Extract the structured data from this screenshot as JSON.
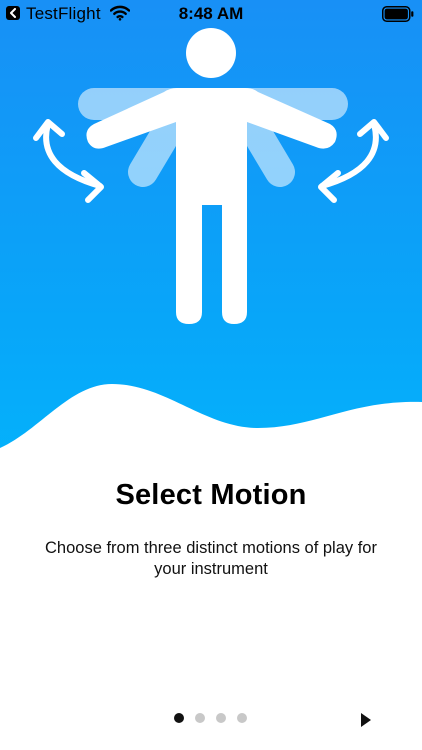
{
  "status_bar": {
    "back_app": "TestFlight",
    "time": "8:48 AM"
  },
  "onboarding": {
    "illustration": "person-motion-icon",
    "title": "Select Motion",
    "description": "Choose from three distinct motions of play for your instrument",
    "page_count": 4,
    "current_page": 1
  },
  "colors": {
    "gradient_top": "#1890f6",
    "gradient_bottom": "#04b1fb",
    "title": "#000000",
    "dot_active": "#111111",
    "dot_inactive": "#c8c8c8"
  },
  "icons": {
    "back": "back-arrow-icon",
    "wifi": "wifi-icon",
    "battery": "battery-icon",
    "next": "next-arrow-icon"
  }
}
